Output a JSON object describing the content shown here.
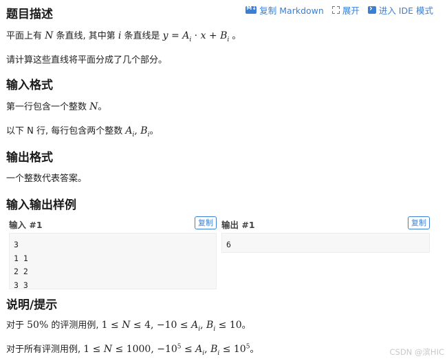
{
  "toolbar": {
    "copy_markdown": "复制 Markdown",
    "expand": "展开",
    "enter_ide": "进入 IDE 模式"
  },
  "description": {
    "title": "题目描述",
    "line1_a": "平面上有 ",
    "line1_b": " 条直线, 其中第 ",
    "line1_c": " 条直线是 ",
    "line1_d": " 。",
    "line2": "请计算这些直线将平面分成了几个部分。"
  },
  "input_format": {
    "title": "输入格式",
    "line1_a": "第一行包含一个整数 ",
    "line1_b": "。",
    "line2_a": "以下 N 行, 每行包含两个整数 ",
    "line2_b": "。"
  },
  "output_format": {
    "title": "输出格式",
    "line1": "一个整数代表答案。"
  },
  "samples": {
    "title": "输入输出样例",
    "input_label": "输入 #1",
    "output_label": "输出 #1",
    "copy_label": "复制",
    "input_lines": [
      "3",
      "1 1",
      "2 2",
      "3 3"
    ],
    "output_lines": [
      "6"
    ]
  },
  "hint": {
    "title": "说明/提示",
    "line1_a": "对于 ",
    "line1_b": " 的评测用例, ",
    "line1_c": "。",
    "line2_a": "对于所有评测用例, ",
    "line2_b": "。"
  },
  "watermark": "CSDN @滨HIC"
}
